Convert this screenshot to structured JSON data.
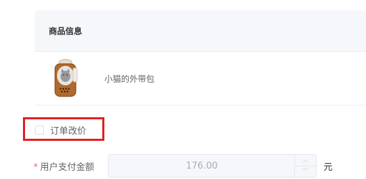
{
  "product_table": {
    "header": "商品信息",
    "rows": [
      {
        "name": "小猫的外带包",
        "thumbnail_icon": "cat-backpack-image"
      }
    ]
  },
  "price_edit": {
    "label": "订单改价",
    "checked": false
  },
  "payment": {
    "required_mark": "*",
    "label": "用户支付金额",
    "value": "176.00",
    "unit": "元"
  },
  "colors": {
    "highlight": "#e02020",
    "required": "#f56c6c"
  }
}
